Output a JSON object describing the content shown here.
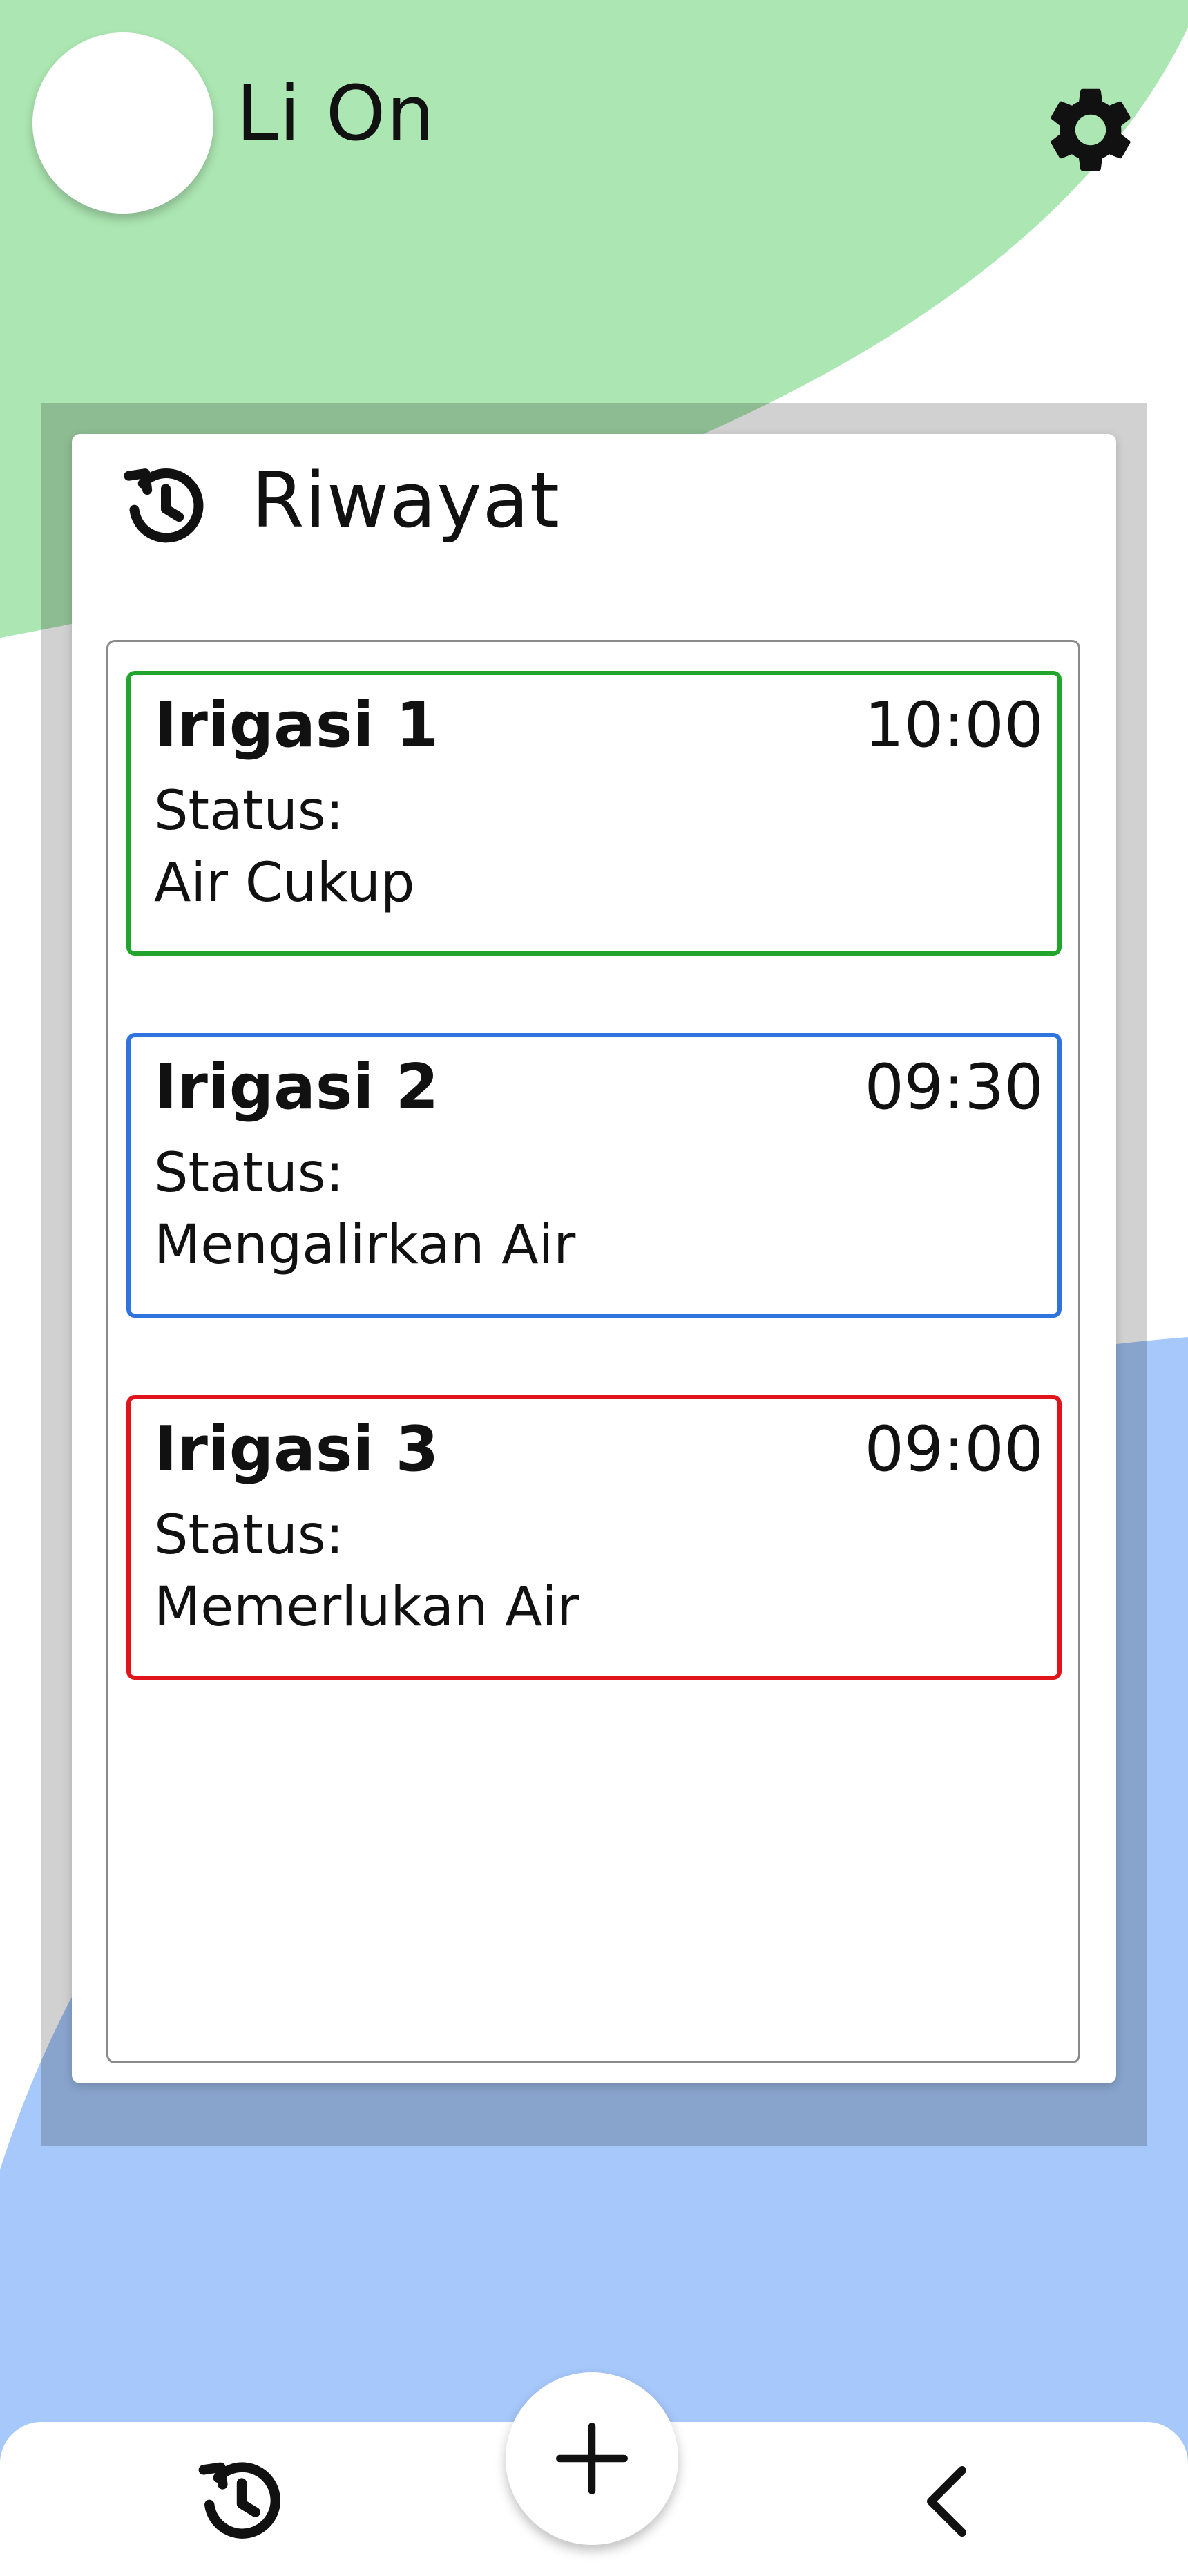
{
  "app": {
    "name": "Li On"
  },
  "colors": {
    "top_shape": "#ace6b2",
    "bottom_shape": "#a7c8fb",
    "irigasi_1": "#22a52d",
    "irigasi_2": "#2f74de",
    "irigasi_3": "#e0141a"
  },
  "icons": {
    "settings": "gear-icon",
    "history": "history-icon",
    "add": "plus-icon",
    "back": "chevron-left-icon"
  },
  "panel": {
    "title": "Riwayat"
  },
  "history": [
    {
      "name": "Irigasi 1",
      "time": "10:00",
      "status_label": "Status:",
      "status": "Air Cukup",
      "color": "#22a52d"
    },
    {
      "name": "Irigasi 2",
      "time": "09:30",
      "status_label": "Status:",
      "status": "Mengalirkan Air",
      "color": "#2f74de"
    },
    {
      "name": "Irigasi 3",
      "time": "09:00",
      "status_label": "Status:",
      "status": "Memerlukan Air",
      "color": "#e0141a"
    }
  ]
}
